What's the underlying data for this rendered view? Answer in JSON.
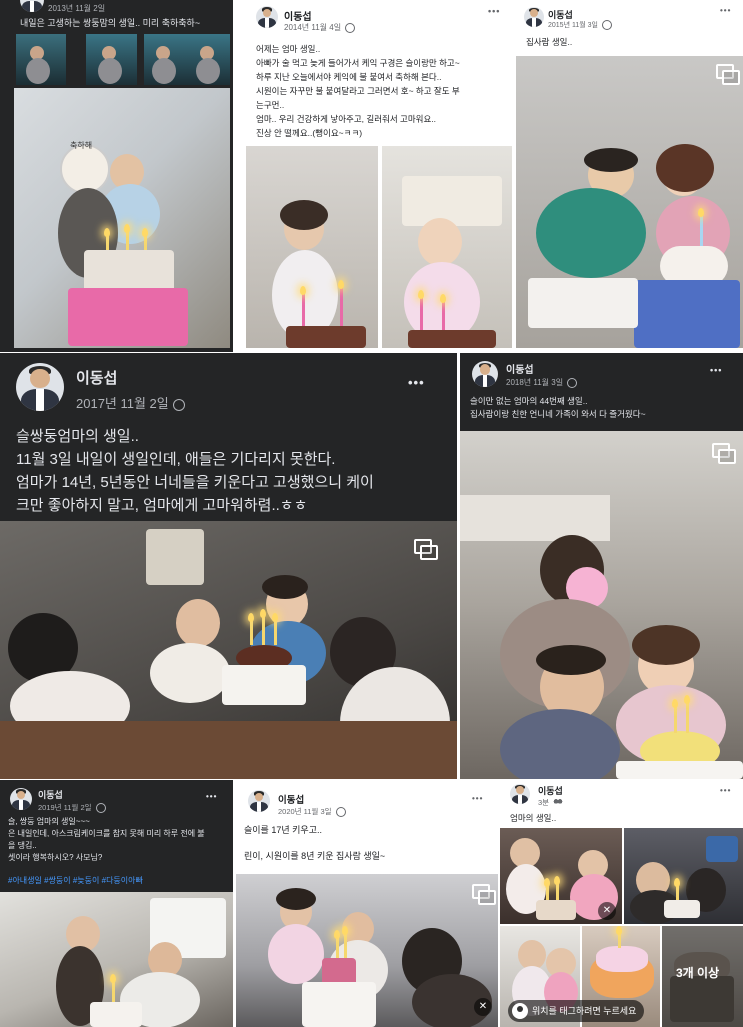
{
  "posts": {
    "p2013": {
      "date": "2013년 11월 2일",
      "text": "내일은 고생하는 쌍둥맘의 생일.. 미리 축하축하~",
      "sticker_text": "축하해"
    },
    "p2014": {
      "author": "이동섭",
      "date": "2014년 11월 4일",
      "more": "•••",
      "text": "어제는 엄마 생일..\n아빠가 술 먹고 늦게 들어가서 케익 구경은 슬이랑만 하고~\n하루 지난 오늘에서야 케익에 불 붙여서 축하해 본다..\n시원이는 자꾸만 불 붙여달라고 그러면서 호~ 하고 잘도 부\n는구먼..\n엄마.. 우리 건강하게 낳아주고, 길러줘서 고마워요..\n진상 안 떨께요..(뻥이요~ㅋㅋ)"
    },
    "p2015": {
      "author": "이동섭",
      "date": "2015년 11월 3일",
      "more": "•••",
      "text": "집사람 생일.."
    },
    "p2017": {
      "author": "이동섭",
      "date": "2017년 11월 2일",
      "more": "•••",
      "text": "슬쌍둥엄마의 생일..\n11월 3일 내일이 생일인데, 애들은 기다리지 못한다.\n엄마가 14년, 5년동안 너네들을 키운다고 고생했으니 케이\n크만 좋아하지 말고, 엄마에게 고마워하렴..ㅎㅎ"
    },
    "p2018": {
      "author": "이동섭",
      "date": "2018년 11월 3일",
      "more": "•••",
      "text": "슬이만 없는 엄마의 44번째 생일..\n집사람이랑 친한 언니네 가족이 와서 다 즐거웠다~"
    },
    "p2019": {
      "author": "이동섭",
      "date": "2019년 11월 2일",
      "more": "•••",
      "text": "슬, 쌍둥 엄마의 생일~~~\n은 내일인데, 아스크림케이크를 참지 못해 미리 하루 전에 불\n을 댕김..\n셋이라 행복하시오? 사모님?",
      "tags": "#아내생일 #쌍둥이 #늦둥이 #다둥이아빠"
    },
    "p2020": {
      "author": "이동섭",
      "date": "2020년 11월 3일",
      "more": "•••",
      "text": "슬이를 17년 키우고..\n\n린이, 시원이를 8년 키운 집사람 생일~"
    },
    "pnew": {
      "author": "이동섭",
      "date": "3분",
      "more": "•••",
      "text": "엄마의 생일..",
      "more_photos": "3개 이상",
      "tag_hint": "위치를 태그하려면 누르세요"
    }
  },
  "colors": {
    "dark_card": "#242526",
    "light_card": "#ffffff",
    "hashtag": "#4599ff",
    "candle_flame": "#ffd966"
  },
  "icons": [
    "more-options-icon",
    "globe-icon",
    "friends-icon",
    "multi-photo-icon",
    "mute-icon",
    "location-pin-icon"
  ]
}
